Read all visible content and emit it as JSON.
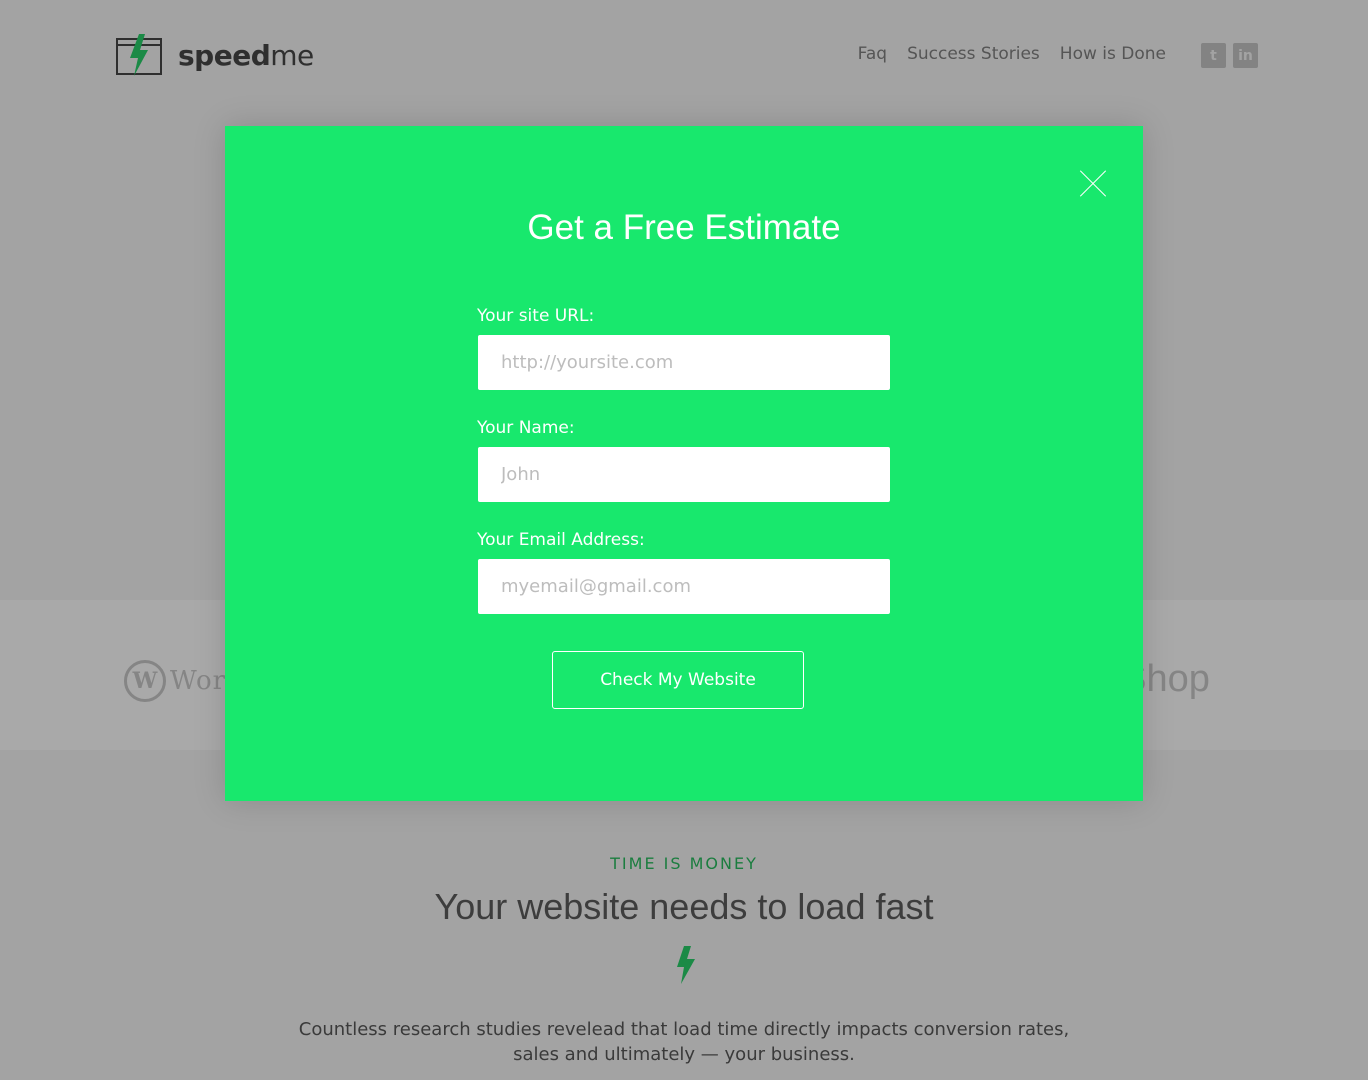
{
  "brand": {
    "name_bold": "speed",
    "name_light": "me",
    "logo_icon": "lightning-window-icon",
    "accent": "#18e86d"
  },
  "nav": {
    "items": [
      {
        "label": "Faq"
      },
      {
        "label": "Success Stories"
      },
      {
        "label": "How is Done"
      }
    ]
  },
  "social": {
    "icons": [
      "twitter-icon",
      "linkedin-icon"
    ]
  },
  "partners": {
    "left_partial": "Wor",
    "right_partial": "aShop"
  },
  "section": {
    "eyebrow": "TIME IS MONEY",
    "headline": "Your website needs to load fast",
    "paragraph_line1": "Countless research studies revelead that load time directly impacts conversion rates,",
    "paragraph_line2": "sales and ultimately — your business."
  },
  "modal": {
    "title": "Get a Free Estimate",
    "fields": [
      {
        "label": "Your site URL:",
        "placeholder": "http://yoursite.com",
        "value": ""
      },
      {
        "label": "Your Name:",
        "placeholder": "John",
        "value": ""
      },
      {
        "label": "Your Email Address:",
        "placeholder": "myemail@gmail.com",
        "value": ""
      }
    ],
    "submit_label": "Check My Website"
  }
}
